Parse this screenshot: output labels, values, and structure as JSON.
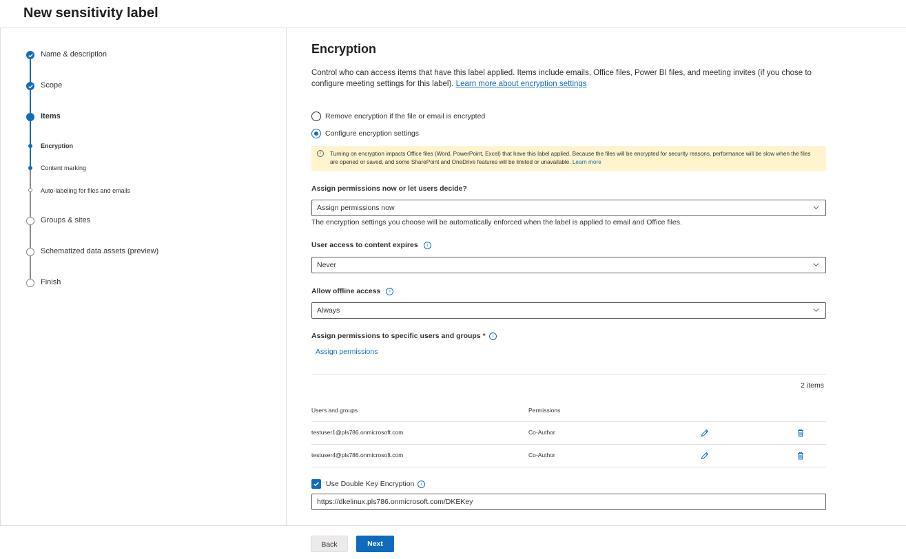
{
  "page": {
    "title": "New sensitivity label"
  },
  "steps": [
    {
      "label": "Name & description",
      "state": "complete"
    },
    {
      "label": "Scope",
      "state": "complete"
    },
    {
      "label": "Items",
      "state": "current"
    },
    {
      "label": "Encryption",
      "state": "current-sub"
    },
    {
      "label": "Content marking",
      "state": "sub"
    },
    {
      "label": "Auto-labeling for files and emails",
      "state": "sub-pending"
    },
    {
      "label": "Groups & sites",
      "state": "pending"
    },
    {
      "label": "Schematized data assets (preview)",
      "state": "pending"
    },
    {
      "label": "Finish",
      "state": "pending"
    }
  ],
  "encryption": {
    "heading": "Encryption",
    "intro": "Control who can access items that have this label applied. Items include emails, Office files, Power BI files, and meeting invites (if you chose to configure meeting settings for this label).",
    "intro_link": "Learn more about encryption settings",
    "radio_remove": "Remove encryption if the file or email is encrypted",
    "radio_configure": "Configure encryption settings",
    "warning_text": "Turning on encryption impacts Office files (Word, PowerPoint, Excel) that have this label applied. Because the files will be encrypted for security reasons, performance will be slow when the files are opened or saved, and some SharePoint and OneDrive features will be limited or unavailable.",
    "warning_link": "Learn more",
    "assign_mode_label": "Assign permissions now or let users decide?",
    "assign_mode_value": "Assign permissions now",
    "assign_mode_helper": "The encryption settings you choose will be automatically enforced when the label is applied to email and Office files.",
    "expires_label": "User access to content expires",
    "expires_value": "Never",
    "offline_label": "Allow offline access",
    "offline_value": "Always",
    "specific_label": "Assign permissions to specific users and groups",
    "required_mark": "*",
    "assign_link": "Assign permissions",
    "items_count": "2 items",
    "col_users": "Users and groups",
    "col_permissions": "Permissions",
    "rows": [
      {
        "user": "testuser1@pls786.onmicrosoft.com",
        "permission": "Co-Author"
      },
      {
        "user": "testuser4@pls786.onmicrosoft.com",
        "permission": "Co-Author"
      }
    ],
    "dke_label": "Use Double Key Encryption",
    "dke_checked": true,
    "dke_url": "https://dkelinux.pls786.onmicrosoft.com/DKEKey"
  },
  "footer": {
    "back": "Back",
    "next": "Next"
  },
  "icons": {
    "info": "info-icon",
    "edit": "pencil-icon",
    "delete": "trash-icon",
    "dropdown": "chevron-down-icon",
    "step_complete": "checkmark-icon"
  },
  "colors": {
    "accent": "#0f6cbd",
    "warning_bg": "#fff4ce",
    "required": "#a4262c"
  }
}
